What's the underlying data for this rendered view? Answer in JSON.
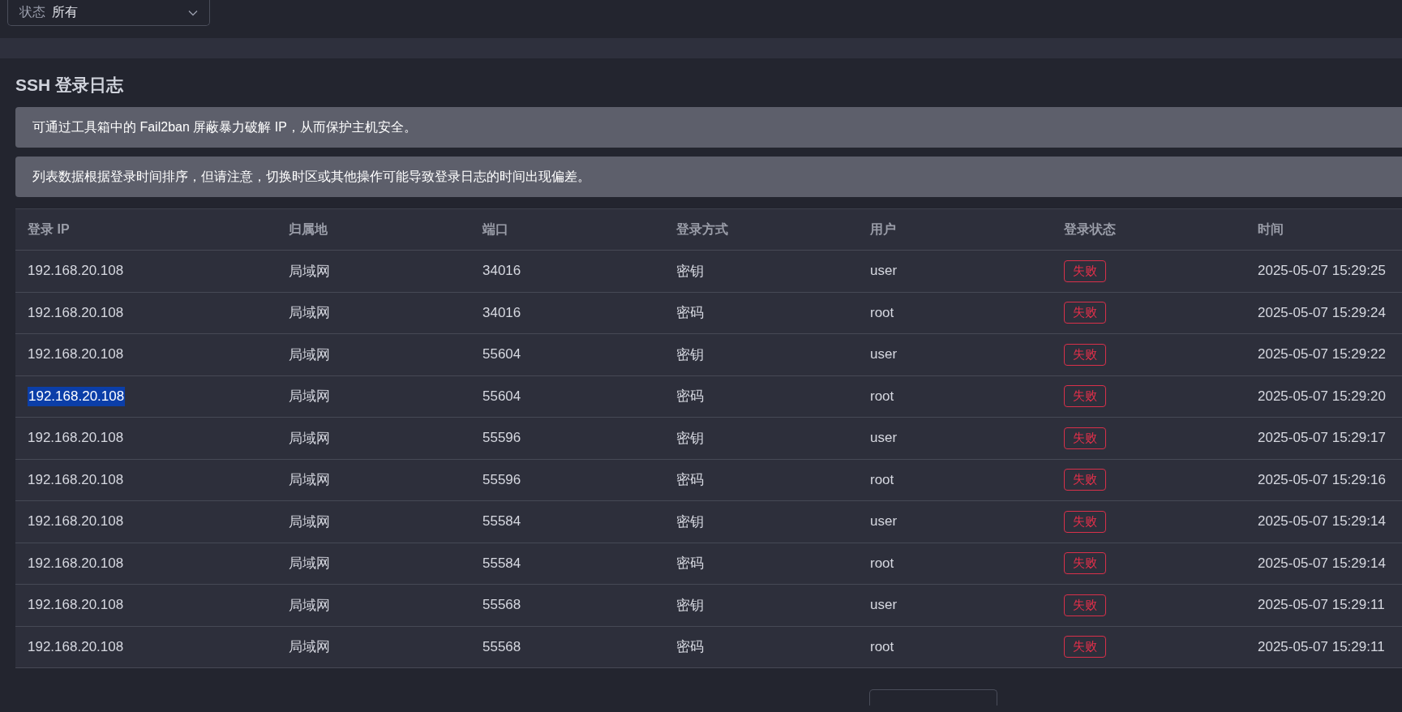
{
  "status_filter": {
    "label": "状态",
    "value": "所有"
  },
  "section": {
    "title": "SSH 登录日志"
  },
  "alerts": [
    "可通过工具箱中的 Fail2ban 屏蔽暴力破解 IP，从而保护主机安全。",
    "列表数据根据登录时间排序，但请注意，切换时区或其他操作可能导致登录日志的时间出现偏差。"
  ],
  "table": {
    "columns": [
      "登录 IP",
      "归属地",
      "端口",
      "登录方式",
      "用户",
      "登录状态",
      "时间"
    ],
    "rows": [
      {
        "ip": "192.168.20.108",
        "ip_selected": false,
        "location": "局域网",
        "port": "34016",
        "method": "密钥",
        "user": "user",
        "status": {
          "label": "失败",
          "kind": "failed"
        },
        "time": "2025-05-07 15:29:25"
      },
      {
        "ip": "192.168.20.108",
        "ip_selected": false,
        "location": "局域网",
        "port": "34016",
        "method": "密码",
        "user": "root",
        "status": {
          "label": "失败",
          "kind": "failed"
        },
        "time": "2025-05-07 15:29:24"
      },
      {
        "ip": "192.168.20.108",
        "ip_selected": false,
        "location": "局域网",
        "port": "55604",
        "method": "密钥",
        "user": "user",
        "status": {
          "label": "失败",
          "kind": "failed"
        },
        "time": "2025-05-07 15:29:22"
      },
      {
        "ip": "192.168.20.108",
        "ip_selected": true,
        "location": "局域网",
        "port": "55604",
        "method": "密码",
        "user": "root",
        "status": {
          "label": "失败",
          "kind": "failed"
        },
        "time": "2025-05-07 15:29:20"
      },
      {
        "ip": "192.168.20.108",
        "ip_selected": false,
        "location": "局域网",
        "port": "55596",
        "method": "密钥",
        "user": "user",
        "status": {
          "label": "失败",
          "kind": "failed"
        },
        "time": "2025-05-07 15:29:17"
      },
      {
        "ip": "192.168.20.108",
        "ip_selected": false,
        "location": "局域网",
        "port": "55596",
        "method": "密码",
        "user": "root",
        "status": {
          "label": "失败",
          "kind": "failed"
        },
        "time": "2025-05-07 15:29:16"
      },
      {
        "ip": "192.168.20.108",
        "ip_selected": false,
        "location": "局域网",
        "port": "55584",
        "method": "密钥",
        "user": "user",
        "status": {
          "label": "失败",
          "kind": "failed"
        },
        "time": "2025-05-07 15:29:14"
      },
      {
        "ip": "192.168.20.108",
        "ip_selected": false,
        "location": "局域网",
        "port": "55584",
        "method": "密码",
        "user": "root",
        "status": {
          "label": "失败",
          "kind": "failed"
        },
        "time": "2025-05-07 15:29:14"
      },
      {
        "ip": "192.168.20.108",
        "ip_selected": false,
        "location": "局域网",
        "port": "55568",
        "method": "密钥",
        "user": "user",
        "status": {
          "label": "失败",
          "kind": "failed"
        },
        "time": "2025-05-07 15:29:11"
      },
      {
        "ip": "192.168.20.108",
        "ip_selected": false,
        "location": "局域网",
        "port": "55568",
        "method": "密码",
        "user": "root",
        "status": {
          "label": "失败",
          "kind": "failed"
        },
        "time": "2025-05-07 15:29:11"
      }
    ]
  }
}
